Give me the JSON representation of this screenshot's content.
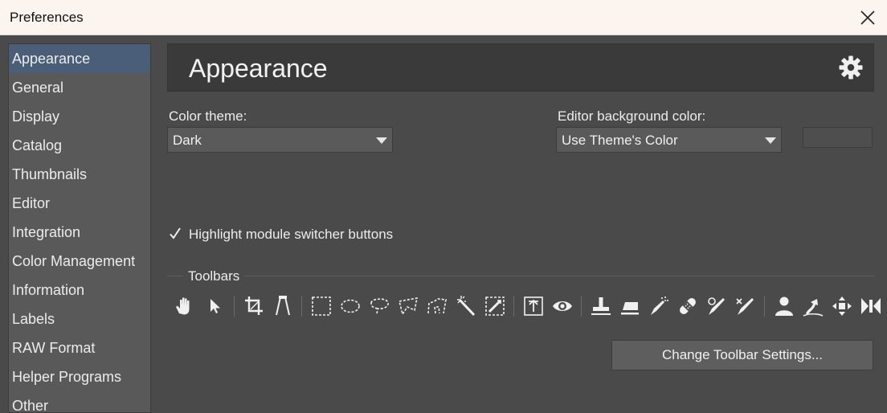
{
  "window": {
    "title": "Preferences"
  },
  "sidebar": {
    "items": [
      {
        "label": "Appearance"
      },
      {
        "label": "General"
      },
      {
        "label": "Display"
      },
      {
        "label": "Catalog"
      },
      {
        "label": "Thumbnails"
      },
      {
        "label": "Editor"
      },
      {
        "label": "Integration"
      },
      {
        "label": "Color Management"
      },
      {
        "label": "Information"
      },
      {
        "label": "Labels"
      },
      {
        "label": "RAW Format"
      },
      {
        "label": "Helper Programs"
      },
      {
        "label": "Other"
      }
    ],
    "selected_index": 0
  },
  "main": {
    "title": "Appearance",
    "color_theme": {
      "label": "Color theme:",
      "value": "Dark"
    },
    "editor_bg": {
      "label": "Editor background color:",
      "value": "Use Theme's Color"
    },
    "highlight_checkbox": {
      "label": "Highlight module switcher buttons",
      "checked": true
    },
    "toolbars": {
      "label": "Toolbars",
      "tools": [
        "hand-tool",
        "select-arrow-tool",
        "crop-tool",
        "perspective-tool",
        "rect-selection-tool",
        "ellipse-selection-tool",
        "lasso-tool",
        "polygon-lasso-tool",
        "magnetic-lasso-tool",
        "magic-wand-tool",
        "gradient-selection-tool",
        "export-tool",
        "red-eye-tool",
        "clone-stamp-tool",
        "eraser-tool",
        "brush-spray-tool",
        "healing-bandage-tool",
        "brush-tool",
        "brush-edit-tool",
        "person-tool",
        "liquify-tool",
        "move-transform-tool",
        "shrink-tool"
      ]
    },
    "change_toolbar_button": "Change Toolbar Settings..."
  },
  "colors": {
    "panel": "#4a4a4a",
    "sidebar": "#595959",
    "selected": "#4b5e78",
    "header": "#3a3a3a",
    "titlebar": "#fbf4ef"
  }
}
